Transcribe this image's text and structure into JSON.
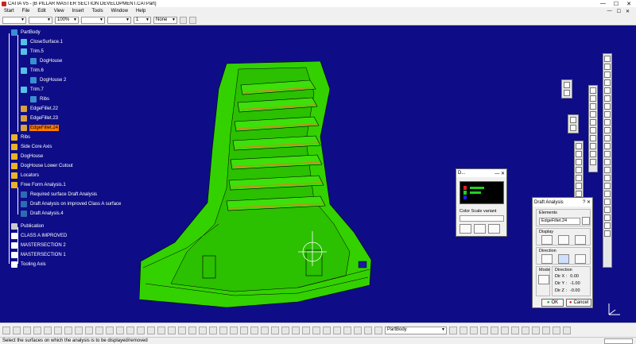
{
  "window": {
    "title": "CATIA V5 - [B PILLAR MASTER SECTION DEVELOPMENT.CATPart]",
    "minimize": "—",
    "maximize": "☐",
    "close": "✕"
  },
  "menu": {
    "items": [
      "Start",
      "File",
      "Edit",
      "View",
      "Insert",
      "Tools",
      "Window",
      "Help"
    ]
  },
  "toolbar_top": {
    "zoom_value": "100%",
    "thickness_value": "1",
    "layer_value": "None"
  },
  "tree": {
    "nodes": [
      {
        "label": "PartBody",
        "icon": "body-icon"
      },
      {
        "label": "CloseSurface.1",
        "icon": "surface-icon"
      },
      {
        "label": "Trim.5",
        "icon": "trim-icon"
      },
      {
        "label": "DogHouse",
        "icon": "body-icon"
      },
      {
        "label": "Trim.6",
        "icon": "trim-icon"
      },
      {
        "label": "DogHouse 2",
        "icon": "body-icon"
      },
      {
        "label": "Trim.7",
        "icon": "trim-icon"
      },
      {
        "label": "Ribs",
        "icon": "body-icon"
      },
      {
        "label": "EdgeFillet.22",
        "icon": "fillet-icon"
      },
      {
        "label": "EdgeFillet.23",
        "icon": "fillet-icon"
      },
      {
        "label": "EdgeFillet.24",
        "icon": "fillet-icon"
      },
      {
        "label": "Ribs",
        "icon": "geoset-icon"
      },
      {
        "label": "Side Core Axis",
        "icon": "geoset-icon"
      },
      {
        "label": "DogHouse",
        "icon": "geoset-icon"
      },
      {
        "label": "DogHouse Lower Cutout",
        "icon": "geoset-icon"
      },
      {
        "label": "Locators",
        "icon": "geoset-icon"
      },
      {
        "label": "Free Form Analysis.1",
        "icon": "geoset-icon"
      },
      {
        "label": "Required surface Draft Analysis",
        "icon": "analysis-icon"
      },
      {
        "label": "Draft Analysis on improved Class A surface",
        "icon": "analysis-icon"
      },
      {
        "label": "Draft Analysis.4",
        "icon": "analysis-icon"
      },
      {
        "label": "Publication",
        "icon": "publication-icon"
      },
      {
        "label": "CLASS A IMPROVED",
        "icon": "axis-icon"
      },
      {
        "label": "MASTERSECTION 2",
        "icon": "axis-icon"
      },
      {
        "label": "MASTERSECTION 1",
        "icon": "axis-icon"
      },
      {
        "label": "Tooling Axis",
        "icon": "axis-icon"
      }
    ],
    "selected_label": "EdgeFillet.24"
  },
  "color_scale_dialog": {
    "title": "D...",
    "variant_label": "Color Scale variant"
  },
  "draft_dialog": {
    "title": "Draft Analysis",
    "help": "?",
    "close": "✕",
    "elements_label": "Elements",
    "elements_value": "EdgeFillet.24",
    "display_label": "Display",
    "direction_label": "Direction",
    "mode_label": "Mode",
    "direction_group_label": "Direction",
    "dir_x_label": "Dir X :",
    "dir_x_value": "0.00",
    "dir_y_label": "Dir Y :",
    "dir_y_value": "-1.00",
    "dir_z_label": "Dir Z :",
    "dir_z_value": "-0.00",
    "ok_label": "OK",
    "cancel_label": "Cancel"
  },
  "toolbar_bottom": {
    "body_combo_value": "PartBody"
  },
  "status": {
    "message": "Select the surfaces on which the analysis is to be displayed/removed"
  },
  "colors": {
    "viewport_bg": "#0e0d87",
    "model_green": "#33d100",
    "selected_highlight": "#ff7a00"
  }
}
